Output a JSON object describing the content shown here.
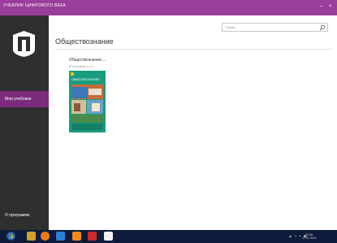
{
  "window": {
    "title": "УЧЕБНИК ЦИФРОВОГО ВЕКА",
    "minimize_glyph": "–",
    "close_glyph": "×"
  },
  "sidebar": {
    "logo_icon": "publisher-logo-icon",
    "nav": [
      {
        "label": "Мои учебники",
        "selected": true
      }
    ],
    "about_label": "О программе"
  },
  "search": {
    "placeholder": "Поиск",
    "icon": "search-icon"
  },
  "main": {
    "title": "Обществознание",
    "books": [
      {
        "title": "Обществознание....",
        "author": "Боголюбов Л. Н....",
        "cover_text": "ОБЩЕСТВОЗНАНИЕ"
      }
    ]
  },
  "taskbar": {
    "buttons": [
      "start-button",
      "ie-icon",
      "explorer-icon",
      "media-player-icon",
      "file-manager-icon",
      "pdf-icon",
      "textbook-app-icon"
    ],
    "time": "20:06",
    "date": "17.01.2014"
  },
  "colors": {
    "accent": "#9a3d9b",
    "sidebar": "#2f2f2f",
    "nav_selected": "#7b2d7c",
    "cover": "#1a9c7e",
    "taskbar": "#0e1b3a"
  }
}
